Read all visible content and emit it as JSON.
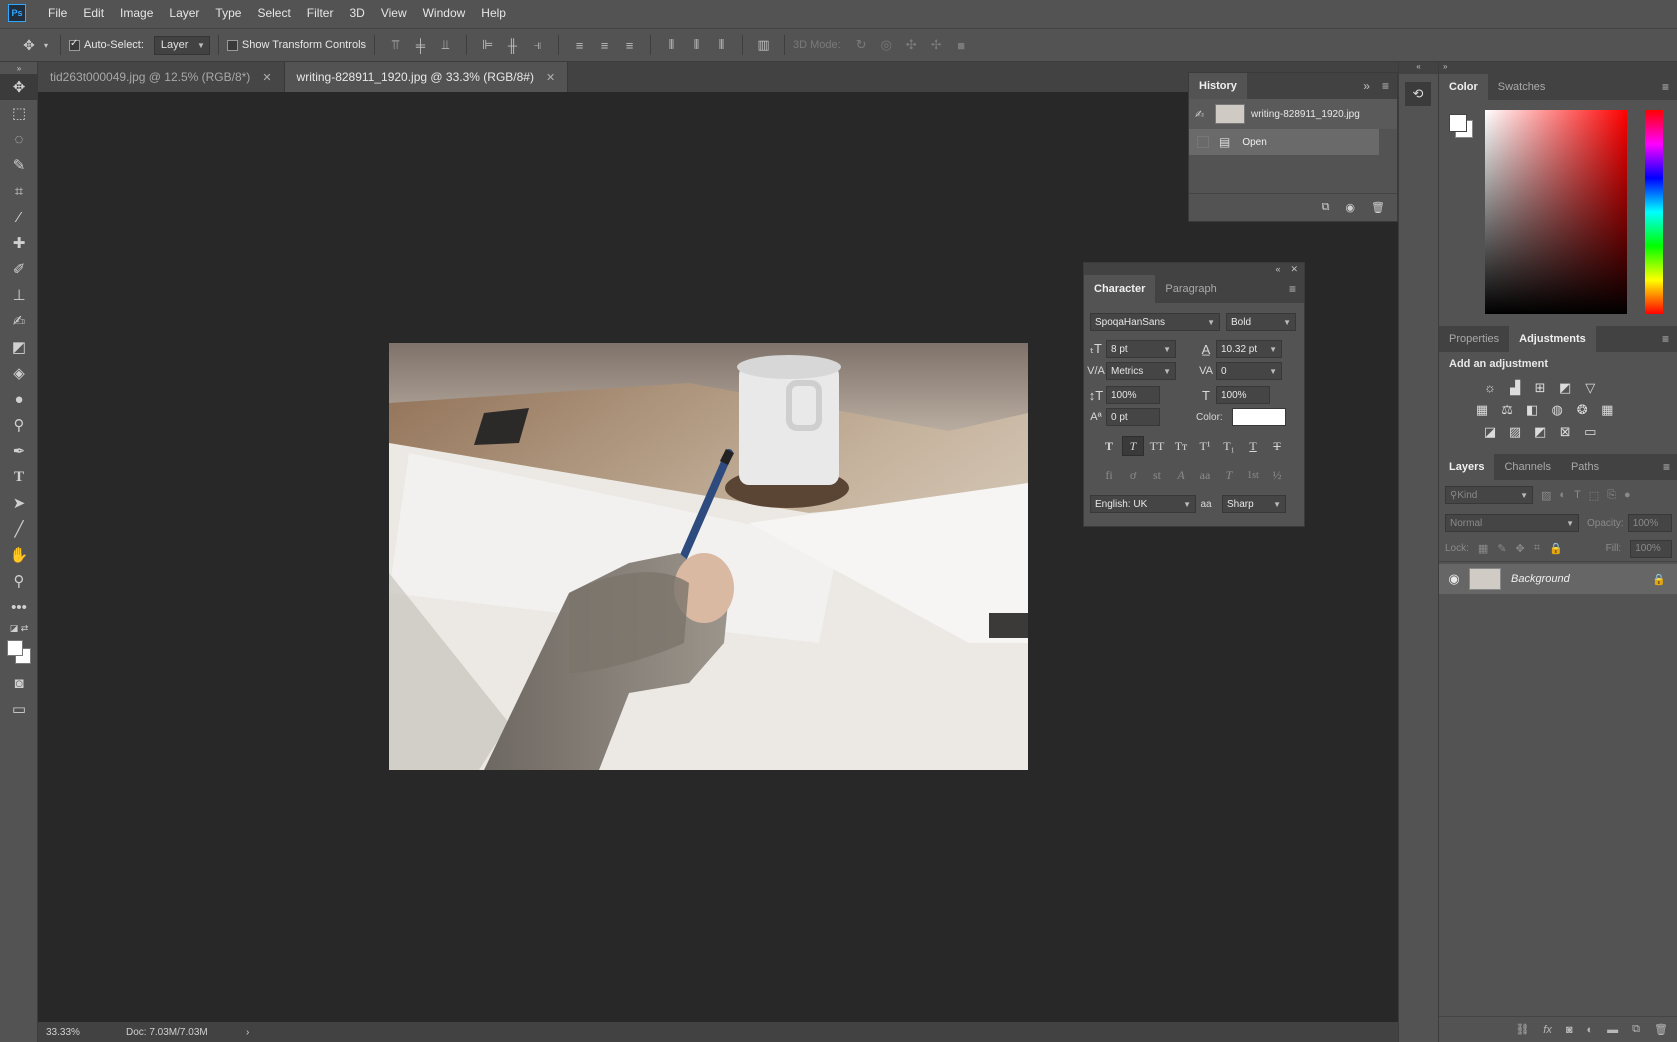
{
  "app": {
    "logo": "Ps"
  },
  "menu": [
    "File",
    "Edit",
    "Image",
    "Layer",
    "Type",
    "Select",
    "Filter",
    "3D",
    "View",
    "Window",
    "Help"
  ],
  "options": {
    "auto_select_label": "Auto-Select:",
    "auto_select_value": "Layer",
    "show_transform_label": "Show Transform Controls",
    "mode_3d_label": "3D Mode:"
  },
  "tabs": [
    {
      "label": "tid263t000049.jpg @ 12.5% (RGB/8*)",
      "active": false
    },
    {
      "label": "writing-828911_1920.jpg @ 33.3% (RGB/8#)",
      "active": true
    }
  ],
  "status": {
    "zoom": "33.33%",
    "doc": "Doc: 7.03M/7.03M"
  },
  "history": {
    "title": "History",
    "snapshot_name": "writing-828911_1920.jpg",
    "items": [
      "Open"
    ]
  },
  "character": {
    "tabs": [
      "Character",
      "Paragraph"
    ],
    "font_family": "SpoqaHanSans",
    "font_style": "Bold",
    "size": "8 pt",
    "leading": "10.32 pt",
    "kerning": "Metrics",
    "tracking": "0",
    "vscale": "100%",
    "hscale": "100%",
    "baseline": "0 pt",
    "color_label": "Color:",
    "language": "English: UK",
    "antialias": "Sharp",
    "aa_icon": "aa",
    "type_buttons": [
      "T",
      "T",
      "TT",
      "Tт",
      "T¹",
      "T₁",
      "T",
      "T"
    ],
    "opentype_buttons": [
      "fi",
      "ơ",
      "st",
      "A",
      "aa",
      "T",
      "1st",
      "½"
    ]
  },
  "color_panel": {
    "tabs": [
      "Color",
      "Swatches"
    ]
  },
  "adjustments": {
    "tabs": [
      "Properties",
      "Adjustments"
    ],
    "hint": "Add an adjustment"
  },
  "layers": {
    "tabs": [
      "Layers",
      "Channels",
      "Paths"
    ],
    "filter_placeholder": "Kind",
    "blend_mode": "Normal",
    "opacity_label": "Opacity:",
    "opacity_value": "100%",
    "lock_label": "Lock:",
    "fill_label": "Fill:",
    "fill_value": "100%",
    "layer_name": "Background"
  }
}
